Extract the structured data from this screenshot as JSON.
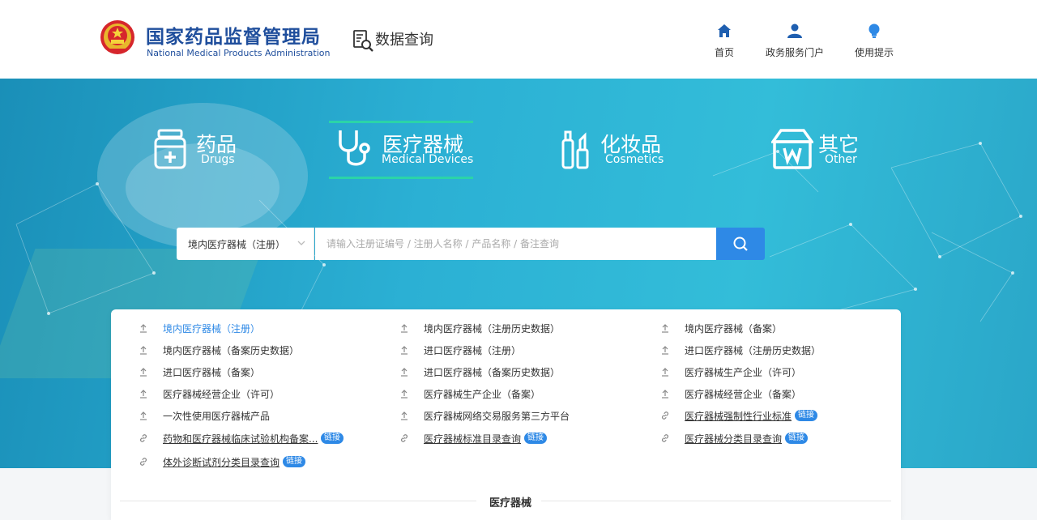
{
  "header": {
    "org_name_cn": "国家药品监督管理局",
    "org_name_en": "National Medical Products Administration",
    "page_title": "数据查询",
    "nav": [
      {
        "label": "首页",
        "icon": "home-icon"
      },
      {
        "label": "政务服务门户",
        "icon": "user-icon"
      },
      {
        "label": "使用提示",
        "icon": "bulb-icon"
      }
    ]
  },
  "categories": [
    {
      "cn": "药品",
      "en": "Drugs",
      "icon": "medicine-box-icon"
    },
    {
      "cn": "医疗器械",
      "en": "Medical Devices",
      "icon": "stethoscope-icon",
      "active": true
    },
    {
      "cn": "化妆品",
      "en": "Cosmetics",
      "icon": "cosmetics-icon"
    },
    {
      "cn": "其它",
      "en": "Other",
      "icon": "store-icon"
    }
  ],
  "search": {
    "selected_type": "境内医疗器械（注册）",
    "placeholder": "请输入注册证编号 / 注册人名称 / 产品名称 / 备注查询"
  },
  "list": {
    "badge_label": "链接",
    "items": [
      {
        "label": "境内医疗器械（注册）",
        "type": "data",
        "active": true
      },
      {
        "label": "境内医疗器械（注册历史数据）",
        "type": "data"
      },
      {
        "label": "境内医疗器械（备案）",
        "type": "data"
      },
      {
        "label": "境内医疗器械（备案历史数据）",
        "type": "data"
      },
      {
        "label": "进口医疗器械（注册）",
        "type": "data"
      },
      {
        "label": "进口医疗器械（注册历史数据）",
        "type": "data"
      },
      {
        "label": "进口医疗器械（备案）",
        "type": "data"
      },
      {
        "label": "进口医疗器械（备案历史数据）",
        "type": "data"
      },
      {
        "label": "医疗器械生产企业（许可）",
        "type": "data"
      },
      {
        "label": "医疗器械经营企业（许可）",
        "type": "data"
      },
      {
        "label": "医疗器械生产企业（备案）",
        "type": "data"
      },
      {
        "label": "医疗器械经营企业（备案）",
        "type": "data"
      },
      {
        "label": "一次性使用医疗器械产品",
        "type": "data"
      },
      {
        "label": "医疗器械网络交易服务第三方平台",
        "type": "data"
      },
      {
        "label": "医疗器械强制性行业标准",
        "type": "link"
      },
      {
        "label": "药物和医疗器械临床试验机构备案...",
        "type": "link"
      },
      {
        "label": "医疗器械标准目录查询",
        "type": "link"
      },
      {
        "label": "医疗器械分类目录查询",
        "type": "link"
      },
      {
        "label": "体外诊断试剂分类目录查询",
        "type": "link"
      }
    ]
  },
  "section_title": "医疗器械",
  "colors": {
    "brand_blue": "#1f4e9c",
    "accent_blue": "#2e89e6",
    "active_underline": "#2bd4a8"
  }
}
